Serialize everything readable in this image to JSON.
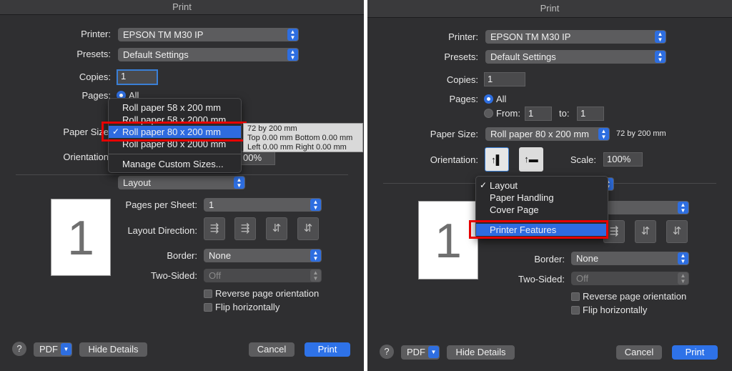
{
  "left": {
    "title": "Print",
    "labels": {
      "printer": "Printer:",
      "presets": "Presets:",
      "copies": "Copies:",
      "pages": "Pages:",
      "paper_size": "Paper Size",
      "orientation": "Orientation",
      "pages_per_sheet": "Pages per Sheet:",
      "layout_direction": "Layout Direction:",
      "border": "Border:",
      "two_sided": "Two-Sided:"
    },
    "printer_value": "EPSON TM M30 IP",
    "presets_value": "Default Settings",
    "copies_value": "1",
    "pages_all": "All",
    "scale_partial": "00%",
    "section_value": "Layout",
    "pages_per_sheet_value": "1",
    "border_value": "None",
    "two_sided_value": "Off",
    "reverse_label": "Reverse page orientation",
    "flip_label": "Flip horizontally",
    "preview_number": "1",
    "paper_menu": {
      "items": [
        "Roll paper 58 x 200 mm",
        "Roll paper 58 x 2000 mm",
        "Roll paper 80 x 200 mm",
        "Roll paper 80 x 2000 mm"
      ],
      "selected": "Roll paper 80 x 200 mm",
      "manage": "Manage Custom Sizes..."
    },
    "tooltip": [
      "72 by 200 mm",
      "Top 0.00 mm Bottom 0.00 mm",
      "Left 0.00 mm Right 0.00 mm"
    ],
    "buttons": {
      "help": "?",
      "pdf": "PDF",
      "hide_details": "Hide Details",
      "cancel": "Cancel",
      "print": "Print"
    }
  },
  "right": {
    "title": "Print",
    "labels": {
      "printer": "Printer:",
      "presets": "Presets:",
      "copies": "Copies:",
      "pages": "Pages:",
      "from": "From:",
      "to": "to:",
      "paper_size": "Paper Size:",
      "orientation": "Orientation:",
      "scale": "Scale:",
      "border": "Border:",
      "two_sided": "Two-Sided:"
    },
    "printer_value": "EPSON TM M30 IP",
    "presets_value": "Default Settings",
    "copies_value": "1",
    "pages_all": "All",
    "from_value": "1",
    "to_value": "1",
    "paper_size_value": "Roll paper 80 x 200 mm",
    "paper_size_note": "72 by 200 mm",
    "scale_value": "100%",
    "border_value": "None",
    "two_sided_value": "Off",
    "reverse_label": "Reverse page orientation",
    "flip_label": "Flip horizontally",
    "preview_number": "1",
    "section_menu": {
      "items": [
        "Layout",
        "Paper Handling",
        "Cover Page"
      ],
      "checked": "Layout",
      "highlighted": "Printer Features"
    },
    "buttons": {
      "help": "?",
      "pdf": "PDF",
      "hide_details": "Hide Details",
      "cancel": "Cancel",
      "print": "Print"
    }
  },
  "colors": {
    "panel_bg": "#2f2f31",
    "accent": "#2e6ee0",
    "highlight_box": "#e60000"
  }
}
